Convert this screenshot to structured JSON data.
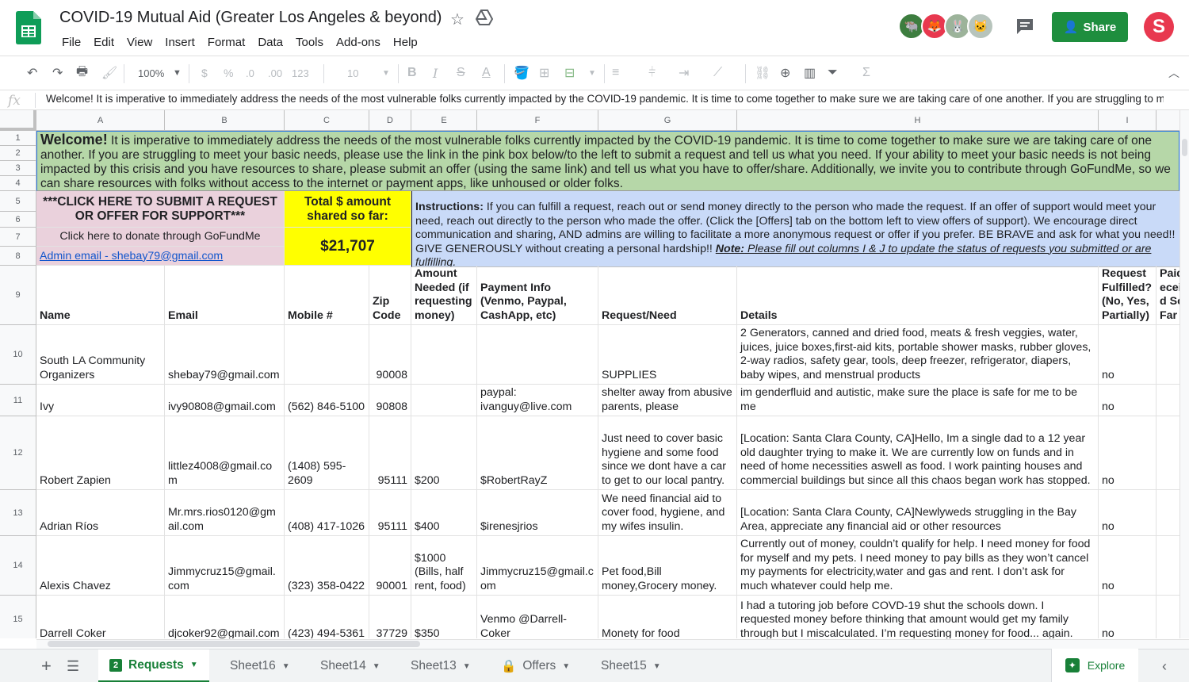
{
  "doc": {
    "title": "COVID-19 Mutual Aid (Greater Los Angeles & beyond)",
    "menu": [
      "File",
      "Edit",
      "View",
      "Insert",
      "Format",
      "Data",
      "Tools",
      "Add-ons",
      "Help"
    ],
    "share_label": "Share",
    "account_initial": "S",
    "collaborators": [
      {
        "color": "#3d7d3f",
        "glyph": "🐃"
      },
      {
        "color": "#e8384f",
        "glyph": "🦊"
      },
      {
        "color": "#9cb39a",
        "glyph": "🐰"
      },
      {
        "color": "#b7c4bc",
        "glyph": "🐱"
      }
    ]
  },
  "toolbar": {
    "zoom": "100%",
    "currency": "$",
    "percent": "%",
    "dec_less": ".0",
    "dec_more": ".00",
    "format_more": "123",
    "font_size": "10",
    "bold": "B",
    "italic": "I",
    "strike": "S",
    "text_color": "A",
    "functions": "Σ"
  },
  "formula_bar": {
    "fx": "fx",
    "text": "Welcome! It is imperative to immediately address the needs of the most vulnerable folks currently impacted by the COVID-19 pandemic. It is time to come together to make sure we are taking care of one another. If you are struggling to meet your basic needs, please use the link in the pink box below/to the left to submit a request and tell us what you need. If your ability to meet your basic needs is not being impacted by this crisis and you are"
  },
  "columns": [
    "A",
    "B",
    "C",
    "D",
    "E",
    "F",
    "G",
    "H",
    "I"
  ],
  "rows": [
    "1",
    "2",
    "3",
    "4",
    "5",
    "6",
    "7",
    "8",
    "9",
    "10",
    "11",
    "12",
    "13",
    "14",
    "15"
  ],
  "welcome": {
    "lead": "Welcome!",
    "text": " It is imperative to immediately address the needs of the most vulnerable folks currently impacted by the COVID-19 pandemic. It is time to come together to make sure we are taking care of one another. If you are struggling to meet your basic needs, please use the link in the pink box below/to the left to submit a request and tell us what you need. If your ability to meet your basic needs is not being impacted by this crisis and you have resources to share, please submit an offer (using the same link) and tell us what you have to offer/share. Additionally, we invite you to contribute through GoFundMe, so we can share resources with folks without access to the internet or payment apps, like unhoused or older folks."
  },
  "banner": {
    "submit": "***CLICK HERE TO SUBMIT A REQUEST OR OFFER FOR SUPPORT***",
    "donate": "Click here to donate through GoFundMe",
    "admin": "Admin email - shebay79@gmail.com",
    "total_label": "Total $ amount shared so far:",
    "total_value": "$21,707",
    "instr_label": "Instructions:",
    "instr_text": " If you can fulfill a request, reach out or send money directly to the person who made the request. If an offer of support would meet your need, reach out directly to the person who made the offer. (Click the [Offers] tab on the bottom left to view offers of support). We encourage direct communication and sharing, AND admins are willing to facilitate a more anonymous request or offer if you prefer. BE BRAVE and ask for what you need!! GIVE GENEROUSLY without creating a personal hardship!! ",
    "instr_note_label": "Note:",
    "instr_note": " Please fill out columns I & J to update the status of requests you submitted or are fulfilling."
  },
  "headers": [
    "Name",
    "Email",
    "Mobile #",
    "Zip Code",
    "Amount Needed (if requesting money)",
    "Payment Info (Venmo, Paypal, CashApp, etc)",
    "Request/Need",
    "Details",
    "Request Fulfilled? (No, Yes, Partially)",
    "Amount Paid/Received So Far"
  ],
  "records": [
    [
      "South LA Community Organizers",
      "shebay79@gmail.com",
      "",
      "90008",
      "",
      "",
      "SUPPLIES",
      "2 Generators, canned and dried food, meats & fresh veggies, water, juices, juice boxes,first-aid kits, portable shower masks, rubber gloves, 2-way radios, safety gear, tools, deep freezer, refrigerator, diapers, baby wipes, and menstrual products",
      "no"
    ],
    [
      "Ivy",
      "ivy90808@gmail.com",
      "(562) 846-5100",
      "90808",
      "",
      "paypal: ivanguy@live.com",
      "shelter away from abusive parents, please",
      "im genderfluid and autistic, make sure the place is safe for me to be me",
      "no"
    ],
    [
      "Robert Zapien",
      "littlez4008@gmail.com",
      "(1408) 595-2609",
      "95111",
      "$200",
      "$RobertRayZ",
      "Just need to cover basic hygiene and some food since we dont have a car to get to our local pantry.",
      "[Location: Santa Clara County, CA]Hello, Im a single dad to a 12 year old daughter trying to make it. We are currently low on funds and in need of home necessities aswell as food. I work painting houses and commercial buildings but since all this chaos began work has stopped.",
      "no"
    ],
    [
      "Adrian Ríos",
      "Mr.mrs.rios0120@gmail.com",
      "(408) 417-1026",
      "95111",
      "$400",
      "$irenesjrios",
      "We need financial aid to cover food, hygiene, and my wifes insulin.",
      "[Location: Santa Clara County, CA]Newlyweds struggling in the Bay Area, appreciate any financial aid or other resources",
      "no"
    ],
    [
      "Alexis Chavez",
      "Jimmycruz15@gmail.com",
      "(323) 358-0422",
      "90001",
      "$1000 (Bills, half rent, food)",
      "Jimmycruz15@gmail.com",
      "Pet food,Bill money,Grocery money.",
      "Currently out of money, couldn’t qualify for help. I need money for food for myself and my pets. I need money to pay bills as they won’t cancel my payments for electricity,water and gas and rent. I don’t ask for much whatever could help me.",
      "no"
    ],
    [
      "Darrell Coker",
      "djcoker92@gmail.com",
      "(423) 494-5361",
      "37729",
      "$350",
      "Venmo @Darrell-Coker",
      "Monety for food",
      "I had a tutoring job before COVD-19 shut the schools down. I requested money before thinking that amount would get my family through but I miscalculated. I’m requesting money for food... again.",
      "no"
    ]
  ],
  "tabs": [
    "Requests",
    "Sheet16",
    "Sheet14",
    "Sheet13",
    "Offers",
    "Sheet15"
  ],
  "explore_label": "Explore"
}
